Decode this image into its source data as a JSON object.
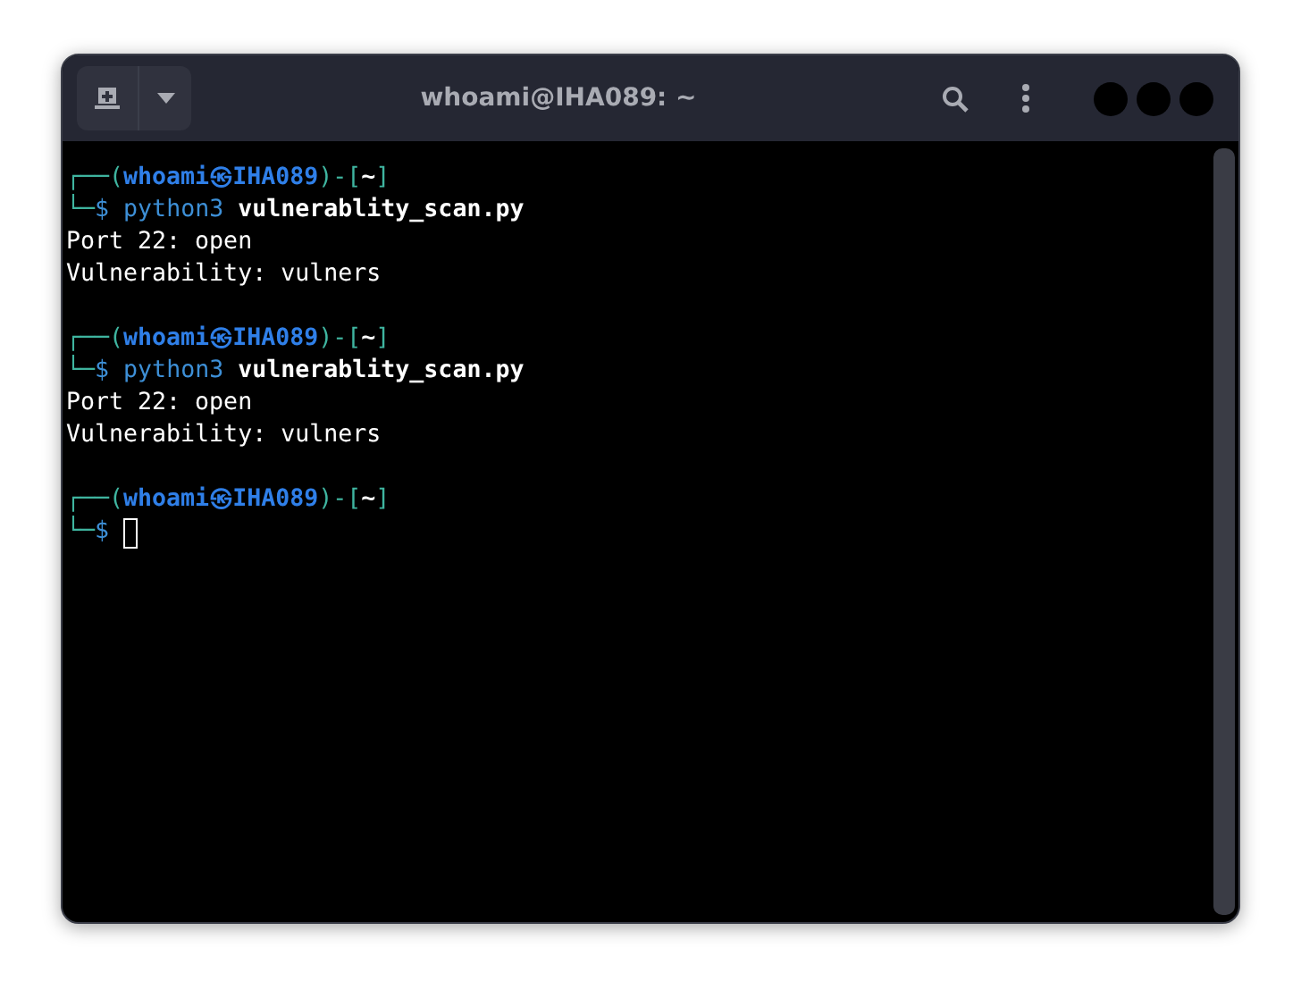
{
  "window": {
    "title": "whoami@IHA089: ~"
  },
  "lines": [
    {
      "kind": "prompt_top",
      "open": "┌──(",
      "user": "whoami",
      "at": "㉿",
      "host": "IHA089",
      "mid": ")-[",
      "dir": "~",
      "close": "]"
    },
    {
      "kind": "prompt_cmd",
      "corner": "└─",
      "sign": "$",
      "command": "python3",
      "arg": "vulnerablity_scan.py",
      "cursor": false
    },
    {
      "kind": "output",
      "text": "Port 22: open"
    },
    {
      "kind": "output",
      "text": "Vulnerability: vulners"
    },
    {
      "kind": "blank"
    },
    {
      "kind": "prompt_top",
      "open": "┌──(",
      "user": "whoami",
      "at": "㉿",
      "host": "IHA089",
      "mid": ")-[",
      "dir": "~",
      "close": "]"
    },
    {
      "kind": "prompt_cmd",
      "corner": "└─",
      "sign": "$",
      "command": "python3",
      "arg": "vulnerablity_scan.py",
      "cursor": false
    },
    {
      "kind": "output",
      "text": "Port 22: open"
    },
    {
      "kind": "output",
      "text": "Vulnerability: vulners"
    },
    {
      "kind": "blank"
    },
    {
      "kind": "prompt_top",
      "open": "┌──(",
      "user": "whoami",
      "at": "㉿",
      "host": "IHA089",
      "mid": ")-[",
      "dir": "~",
      "close": "]"
    },
    {
      "kind": "prompt_cmd",
      "corner": "└─",
      "sign": "$",
      "cursor": true
    }
  ]
}
